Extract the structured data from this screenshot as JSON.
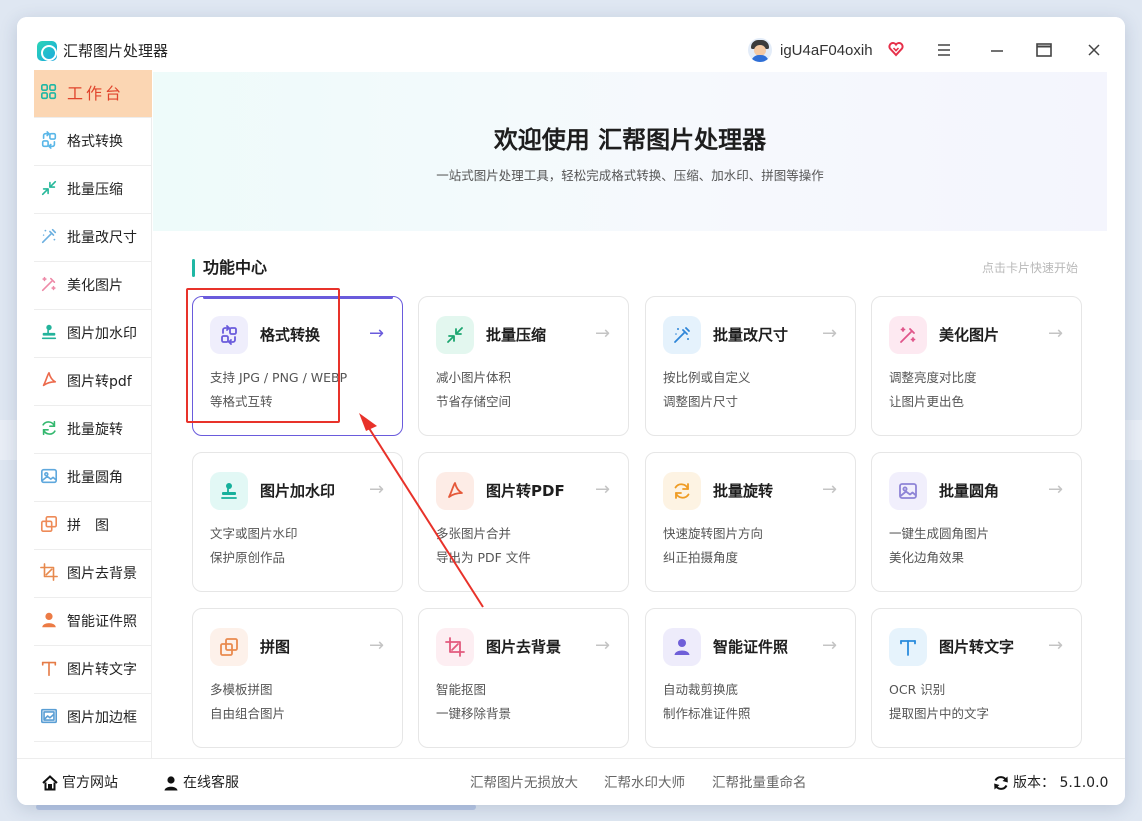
{
  "app": {
    "title": "汇帮图片处理器",
    "username": "igU4aF04oxih"
  },
  "window_icons": [
    "menu-icon",
    "minimize-icon",
    "maximize-icon",
    "close-icon"
  ],
  "sidebar": {
    "items": [
      {
        "label": "工作台",
        "icon": "grid-icon",
        "active": true
      },
      {
        "label": "格式转换",
        "icon": "convert-icon"
      },
      {
        "label": "批量压缩",
        "icon": "compress-icon"
      },
      {
        "label": "批量改尺寸",
        "icon": "resize-icon"
      },
      {
        "label": "美化图片",
        "icon": "magic-icon"
      },
      {
        "label": "图片加水印",
        "icon": "stamp-icon"
      },
      {
        "label": "图片转pdf",
        "icon": "pdf-icon"
      },
      {
        "label": "批量旋转",
        "icon": "rotate-icon"
      },
      {
        "label": "批量圆角",
        "icon": "image-icon"
      },
      {
        "label": "拼　图",
        "icon": "collage-icon"
      },
      {
        "label": "图片去背景",
        "icon": "crop-icon"
      },
      {
        "label": "智能证件照",
        "icon": "person-icon"
      },
      {
        "label": "图片转文字",
        "icon": "text-icon"
      },
      {
        "label": "图片加边框",
        "icon": "frame-icon"
      }
    ]
  },
  "hero": {
    "title": "欢迎使用 汇帮图片处理器",
    "subtitle": "一站式图片处理工具，轻松完成格式转换、压缩、加水印、拼图等操作"
  },
  "section": {
    "title": "功能中心",
    "hint": "点击卡片快速开始"
  },
  "cards": [
    {
      "title": "格式转换",
      "d1": "支持 JPG / PNG / WEBP",
      "d2": "等格式互转",
      "icon": "convert-icon",
      "bg": "#efeefc",
      "color": "#6a5bdc",
      "selected": true
    },
    {
      "title": "批量压缩",
      "d1": "减小图片体积",
      "d2": "节省存储空间",
      "icon": "compress-icon",
      "bg": "#e3f7ef",
      "color": "#1ca670"
    },
    {
      "title": "批量改尺寸",
      "d1": "按比例或自定义",
      "d2": "调整图片尺寸",
      "icon": "resize-icon",
      "bg": "#e5f2fc",
      "color": "#2f86d8"
    },
    {
      "title": "美化图片",
      "d1": "调整亮度对比度",
      "d2": "让图片更出色",
      "icon": "magic-icon",
      "bg": "#fde9f1",
      "color": "#e0558a"
    },
    {
      "title": "图片加水印",
      "d1": "文字或图片水印",
      "d2": "保护原创作品",
      "icon": "stamp-icon",
      "bg": "#e2f8f5",
      "color": "#16b09b"
    },
    {
      "title": "图片转PDF",
      "d1": "多张图片合并",
      "d2": "导出为 PDF 文件",
      "icon": "pdf-icon",
      "bg": "#fdece6",
      "color": "#e5593a"
    },
    {
      "title": "批量旋转",
      "d1": "快速旋转图片方向",
      "d2": "纠正拍摄角度",
      "icon": "rotate-icon",
      "bg": "#fdf3e3",
      "color": "#ef9c24"
    },
    {
      "title": "批量圆角",
      "d1": "一键生成圆角图片",
      "d2": "美化边角效果",
      "icon": "image-icon",
      "bg": "#f1effc",
      "color": "#8e84d6"
    },
    {
      "title": "拼图",
      "d1": "多模板拼图",
      "d2": "自由组合图片",
      "icon": "collage-icon",
      "bg": "#fdf1ea",
      "color": "#e98a4e"
    },
    {
      "title": "图片去背景",
      "d1": "智能抠图",
      "d2": "一键移除背景",
      "icon": "crop-icon",
      "bg": "#fdeef2",
      "color": "#e25a7d"
    },
    {
      "title": "智能证件照",
      "d1": "自动裁剪换底",
      "d2": "制作标准证件照",
      "icon": "person-icon",
      "bg": "#eeecfb",
      "color": "#6f5fd8"
    },
    {
      "title": "图片转文字",
      "d1": "OCR 识别",
      "d2": "提取图片中的文字",
      "icon": "text-icon",
      "bg": "#e6f3fc",
      "color": "#2a8bdc"
    }
  ],
  "card_arrow": "→",
  "footer": {
    "official_site": "官方网站",
    "support": "在线客服",
    "link1": "汇帮图片无损放大",
    "link2": "汇帮水印大师",
    "link3": "汇帮批量重命名",
    "version": "版本：  5.1.0.0"
  }
}
